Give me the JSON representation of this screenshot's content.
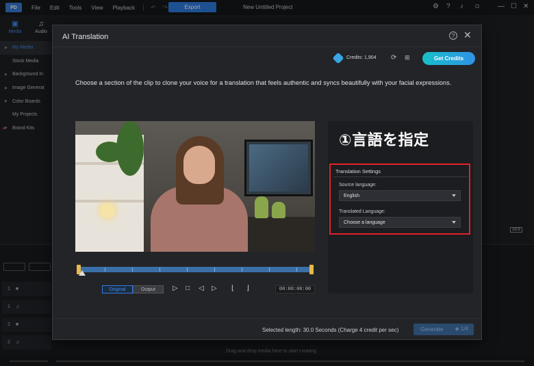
{
  "menubar": {
    "logo": "PD",
    "items": [
      "File",
      "Edit",
      "Tools",
      "View",
      "Playback"
    ],
    "export_label": "Export",
    "project_title": "New Untitled Project",
    "icons": [
      "settings-icon",
      "help-icon",
      "bell-icon",
      "user-icon",
      "minimize-icon",
      "maximize-icon",
      "close-icon"
    ]
  },
  "left_tabs": [
    {
      "label": "Media",
      "icon": "media-icon"
    },
    {
      "label": "Audio",
      "icon": "audio-icon"
    }
  ],
  "library": {
    "items": [
      {
        "label": "My Media",
        "active": true
      },
      {
        "label": "Stock Media"
      },
      {
        "label": "Background In"
      },
      {
        "label": "Image Generat"
      },
      {
        "label": "Color Boards"
      },
      {
        "label": "My Projects"
      },
      {
        "label": "Brand Kits"
      }
    ]
  },
  "timeline": {
    "tracks": [
      "1",
      "1",
      "2",
      "2"
    ],
    "drop_hint": "Drag and drop media here to start creating",
    "ratio": "16:9"
  },
  "dialog": {
    "title": "AI Translation",
    "credits_label": "Credits: 1,904",
    "get_credits_label": "Get Credits",
    "instructions": "Choose a section of the clip to clone your voice for a translation that feels authentic and syncs beautifully with your facial expressions.",
    "annotation": "①言語を指定",
    "settings": {
      "title": "Translation Settings",
      "source_label": "Source language:",
      "source_value": "English",
      "translated_label": "Translated Language:",
      "translated_value": "Choose a language"
    },
    "player": {
      "original_label": "Original",
      "output_label": "Output",
      "timecode": "00:00:00:00"
    },
    "footer": {
      "selected_length": "Selected length: 30.0 Seconds (Charge 4 credit per sec)",
      "generate_label": "Generate"
    }
  }
}
